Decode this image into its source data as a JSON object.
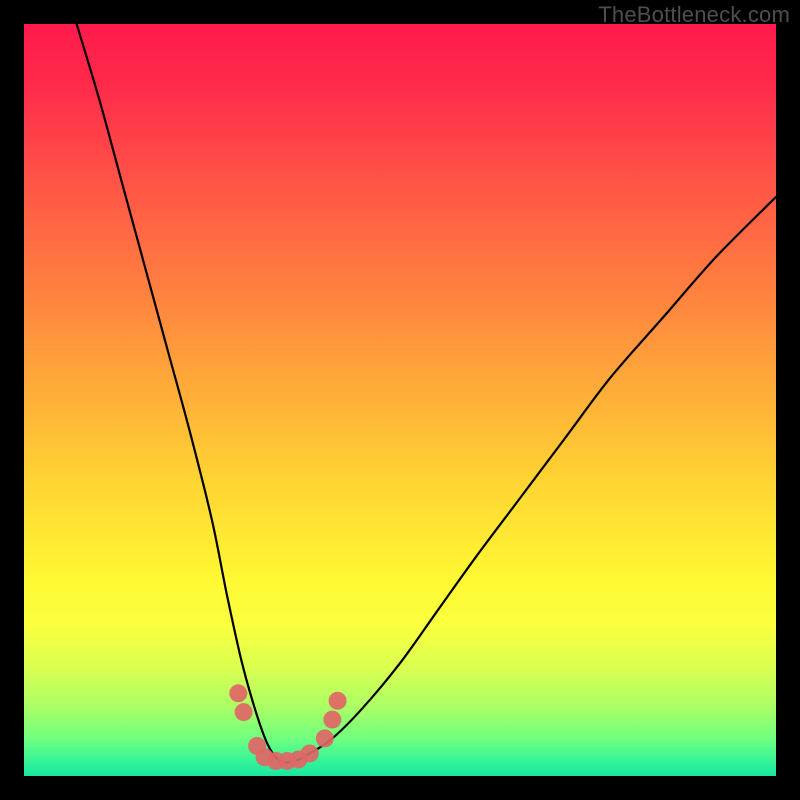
{
  "watermark": "TheBottleneck.com",
  "chart_data": {
    "type": "line",
    "title": "",
    "xlabel": "",
    "ylabel": "",
    "xlim": [
      0,
      100
    ],
    "ylim": [
      0,
      100
    ],
    "series": [
      {
        "name": "bottleneck-curve",
        "x": [
          7,
          10,
          13,
          16,
          19,
          22,
          25,
          27,
          29,
          31,
          32.5,
          34,
          36,
          38,
          41,
          45,
          50,
          55,
          60,
          66,
          72,
          78,
          85,
          92,
          100
        ],
        "values": [
          100,
          90,
          79,
          68,
          57,
          46,
          34,
          24,
          15,
          8,
          4,
          2,
          2,
          3,
          5,
          9,
          15,
          22,
          29,
          37,
          45,
          53,
          61,
          69,
          77
        ]
      }
    ],
    "markers": {
      "name": "highlight-dots",
      "color": "#e06666",
      "points": [
        {
          "x": 28.5,
          "y": 11
        },
        {
          "x": 29.2,
          "y": 8.5
        },
        {
          "x": 31.0,
          "y": 4.0
        },
        {
          "x": 32.0,
          "y": 2.5
        },
        {
          "x": 33.5,
          "y": 2.0
        },
        {
          "x": 35.0,
          "y": 2.0
        },
        {
          "x": 36.5,
          "y": 2.2
        },
        {
          "x": 38.0,
          "y": 3.0
        },
        {
          "x": 40.0,
          "y": 5.0
        },
        {
          "x": 41.0,
          "y": 7.5
        },
        {
          "x": 41.7,
          "y": 10.0
        }
      ]
    },
    "gradient_stops": [
      {
        "pos": 0,
        "color": "#ff1a4d"
      },
      {
        "pos": 50,
        "color": "#ffb138"
      },
      {
        "pos": 74,
        "color": "#fff933"
      },
      {
        "pos": 100,
        "color": "#1ae6a0"
      }
    ]
  }
}
